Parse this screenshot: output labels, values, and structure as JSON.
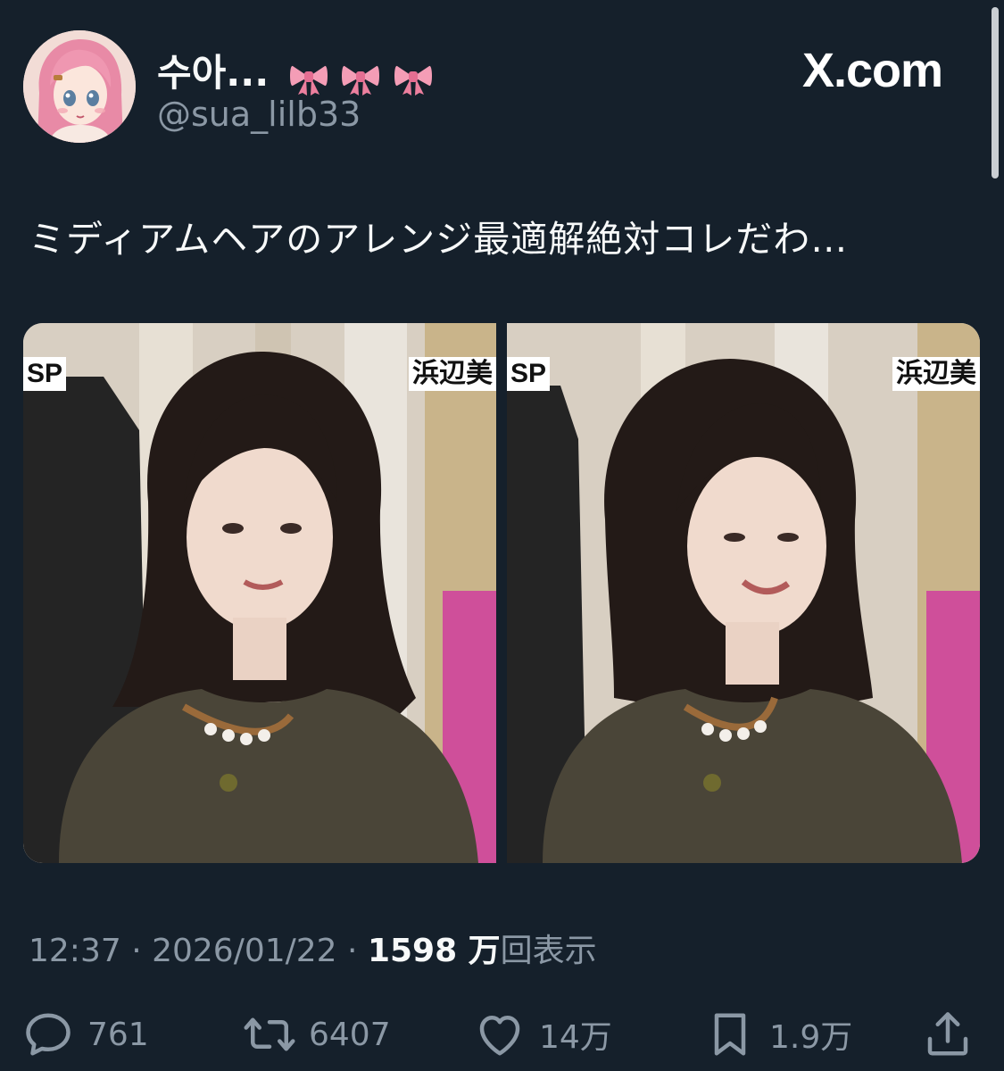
{
  "author": {
    "display_name": "수아...",
    "display_name_emoji": "bow-emoji",
    "handle": "@sua_lilb33",
    "avatar_icon": "anime-girl-avatar"
  },
  "site_label": "X.com",
  "tweet": {
    "text": "ミディアムヘアのアレンジ最適解絶対コレだわ…"
  },
  "media": [
    {
      "caption_left": "SP",
      "caption_right": "浜辺美"
    },
    {
      "caption_left": "SP",
      "caption_right": "浜辺美"
    }
  ],
  "meta": {
    "time": "12:37",
    "separator": " · ",
    "date": "2026/01/22",
    "views_count": "1598 万",
    "views_label": "回表示"
  },
  "actions": {
    "reply": {
      "icon": "reply-icon",
      "count": "761"
    },
    "retweet": {
      "icon": "retweet-icon",
      "count": "6407"
    },
    "like": {
      "icon": "heart-icon",
      "count": "14万"
    },
    "bookmark": {
      "icon": "bookmark-icon",
      "count": "1.9万"
    },
    "share": {
      "icon": "share-icon"
    }
  },
  "colors": {
    "background": "#15202b",
    "text_primary": "#f7f9f9",
    "text_secondary": "#8b98a5"
  }
}
